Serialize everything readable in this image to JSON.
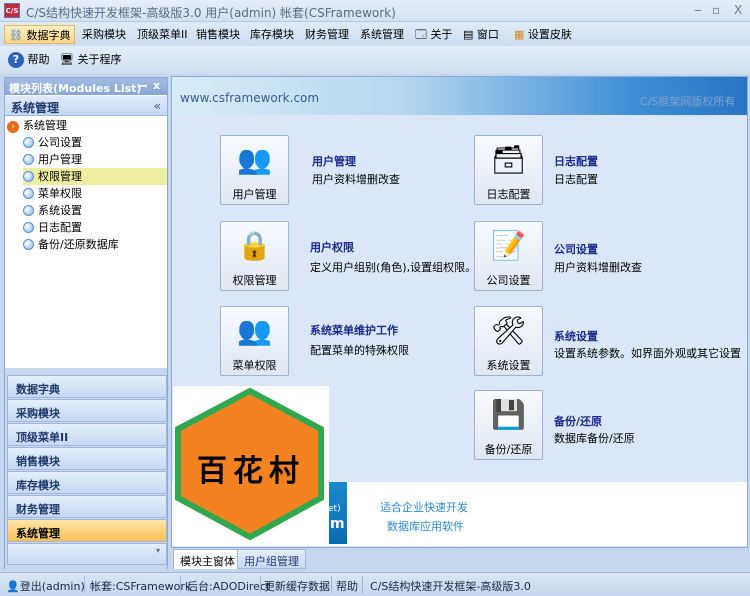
{
  "window": {
    "title": "C/S结构快速开发框架-高级版3.0 用户(admin) 帐套(CSFramework)",
    "icon_text": "C/S",
    "min": "‒",
    "max": "▫",
    "close": "X"
  },
  "menu": [
    {
      "label": "数据字典",
      "active": true
    },
    {
      "label": "采购模块"
    },
    {
      "label": "顶级菜单II"
    },
    {
      "label": "销售模块"
    },
    {
      "label": "库存模块"
    },
    {
      "label": "财务管理"
    },
    {
      "label": "系统管理"
    },
    {
      "label": "关于"
    },
    {
      "label": "窗口"
    },
    {
      "label": "设置皮肤"
    }
  ],
  "toolbar": {
    "help": "帮助",
    "about": "关于程序"
  },
  "left_panel": {
    "title": "模块列表(Modules List)",
    "pin": "ꟷ",
    "close": "x",
    "group": "系统管理",
    "collapse": "«",
    "tree_root": "系统管理",
    "tree": [
      "公司设置",
      "用户管理",
      "权限管理",
      "菜单权限",
      "系统设置",
      "日志配置",
      "备份/还原数据库"
    ],
    "selected": "权限管理",
    "nav": [
      "数据字典",
      "采购模块",
      "顶级菜单II",
      "销售模块",
      "库存模块",
      "财务管理",
      "系统管理"
    ],
    "active_nav": "系统管理"
  },
  "banner": {
    "url": "www.csframework.com",
    "copyright": "C/S框架网版权所有"
  },
  "tiles": [
    {
      "label": "用户管理",
      "title": "用户管理",
      "desc": "用户资料增删改查",
      "icon": "users-icon"
    },
    {
      "label": "日志配置",
      "title": "日志配置",
      "desc": "日志配置",
      "icon": "log-icon"
    },
    {
      "label": "权限管理",
      "title": "用户权限",
      "desc": "定义用户组别(角色),设置组权限。",
      "icon": "lock-icon"
    },
    {
      "label": "公司设置",
      "title": "公司设置",
      "desc": "用户资料增删改查",
      "icon": "notepad-icon"
    },
    {
      "label": "菜单权限",
      "title": "系统菜单维护工作",
      "desc": "配置菜单的特殊权限",
      "icon": "menu-users-icon"
    },
    {
      "label": "系统设置",
      "title": "系统设置",
      "desc": "设置系统参数。如界面外观或其它设置",
      "icon": "tools-icon"
    },
    {
      "label": "备份/还原",
      "title": "备份/还原",
      "desc": "数据库备份/还原",
      "icon": "backup-icon"
    }
  ],
  "promo": {
    "line1": "适合企业快速开发",
    "line2": "数据库应用软件",
    "partial1": "et)",
    "partial2": "m"
  },
  "logo": {
    "text": "百花村"
  },
  "tabs": [
    "模块主窗体",
    "用户组管理"
  ],
  "status": [
    "登出(admin)",
    "帐套:CSFramework",
    "后台:ADODirect",
    "更新缓存数据",
    "帮助",
    "C/S结构快速开发框架-高级版3.0"
  ]
}
